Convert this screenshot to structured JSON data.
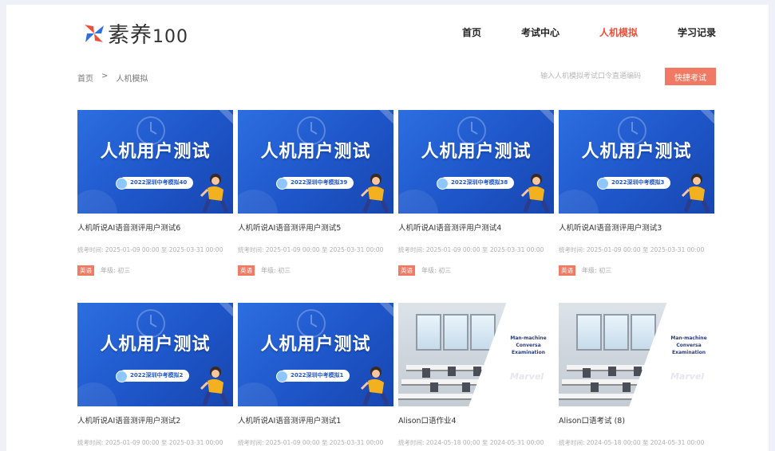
{
  "logo": {
    "name": "素养",
    "num": "100"
  },
  "nav": [
    {
      "label": "首页",
      "active": false
    },
    {
      "label": "考试中心",
      "active": false
    },
    {
      "label": "人机模拟",
      "active": true
    },
    {
      "label": "学习记录",
      "active": false
    }
  ],
  "breadcrumb": {
    "home": "首页",
    "sep": ">",
    "current": "人机模拟"
  },
  "search": {
    "placeholder": "输入人机模拟考试口令直通编码",
    "button": "快捷考试"
  },
  "cards": [
    {
      "type": "blue",
      "banner_title": "人机用户测试",
      "banner_pill": "2022深圳中考模拟40",
      "name": "人机听说AI语音测评用户测试6",
      "time": "统考时间: 2025-01-09 00:00 至 2025-03-31 00:00",
      "tag": "英语",
      "grade": "年级: 初三"
    },
    {
      "type": "blue",
      "banner_title": "人机用户测试",
      "banner_pill": "2022深圳中考模拟39",
      "name": "人机听说AI语音测评用户测试5",
      "time": "统考时间: 2025-01-09 00:00 至 2025-03-31 00:00",
      "tag": "英语",
      "grade": "年级: 初三"
    },
    {
      "type": "blue",
      "banner_title": "人机用户测试",
      "banner_pill": "2022深圳中考模拟38",
      "name": "人机听说AI语音测评用户测试4",
      "time": "统考时间: 2025-01-09 00:00 至 2025-03-31 00:00",
      "tag": "英语",
      "grade": "年级: 初三"
    },
    {
      "type": "blue",
      "banner_title": "人机用户测试",
      "banner_pill": "2022深圳中考模拟3",
      "name": "人机听说AI语音测评用户测试3",
      "time": "统考时间: 2025-01-09 00:00 至 2025-03-31 00:00",
      "tag": "英语",
      "grade": "年级: 初三"
    },
    {
      "type": "blue",
      "banner_title": "人机用户测试",
      "banner_pill": "2022深圳中考模拟2",
      "name": "人机听说AI语音测评用户测试2",
      "time": "统考时间: 2025-01-09 00:00 至 2025-03-31 00:00",
      "tag": "",
      "grade": ""
    },
    {
      "type": "blue",
      "banner_title": "人机用户测试",
      "banner_pill": "2022深圳中考模拟1",
      "name": "人机听说AI语音测评用户测试1",
      "time": "统考时间: 2025-01-09 00:00 至 2025-03-31 00:00",
      "tag": "",
      "grade": ""
    },
    {
      "type": "photo",
      "banner_eng": "Man-machine Conversa Examination",
      "banner_wm": "Marvel",
      "name": "Alison口语作业4",
      "time": "统考时间: 2024-05-18 00:00 至 2024-05-31 00:00",
      "tag": "",
      "grade": ""
    },
    {
      "type": "photo",
      "banner_eng": "Man-machine Conversa Examination",
      "banner_wm": "Marvel",
      "name": "Alison口语考试 (8)",
      "time": "统考时间: 2024-05-18 00:00 至 2024-05-31 00:00",
      "tag": "",
      "grade": ""
    }
  ],
  "colors": {
    "accent": "#e8523c",
    "button": "#f07a63",
    "banner": "#2c6ee0"
  }
}
